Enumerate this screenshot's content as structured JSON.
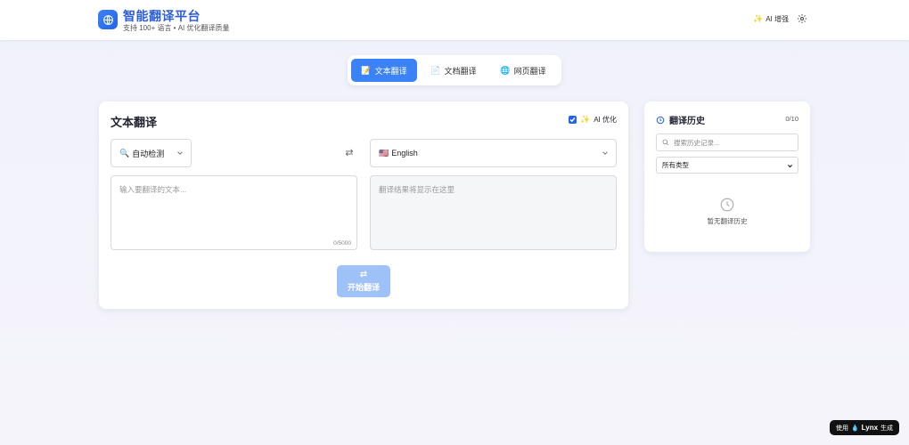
{
  "header": {
    "title": "智能翻译平台",
    "subtitle": "支持 100+ 语言 • AI 优化翻译质量",
    "ai_boost": "AI 增强"
  },
  "tabs": [
    {
      "label": "文本翻译",
      "active": true
    },
    {
      "label": "文档翻译",
      "active": false
    },
    {
      "label": "网页翻译",
      "active": false
    }
  ],
  "main": {
    "title": "文本翻译",
    "ai_optimize": "AI 优化",
    "source_lang": "自动检测",
    "target_lang": "English",
    "source_placeholder": "输入要翻译的文本...",
    "target_placeholder": "翻译结果将显示在这里",
    "char_count": "0/5000",
    "translate_button": "开始翻译"
  },
  "history": {
    "title": "翻译历史",
    "count": "0/10",
    "search_placeholder": "搜索历史记录...",
    "filter": "所有类型",
    "empty": "暂无翻译历史"
  },
  "badge": {
    "prefix": "使用",
    "brand": "Lynx",
    "suffix": "生成"
  },
  "colors": {
    "accent": "#3b82f6",
    "title": "#2f5fd8",
    "disabled_button": "#9ec1f7"
  }
}
